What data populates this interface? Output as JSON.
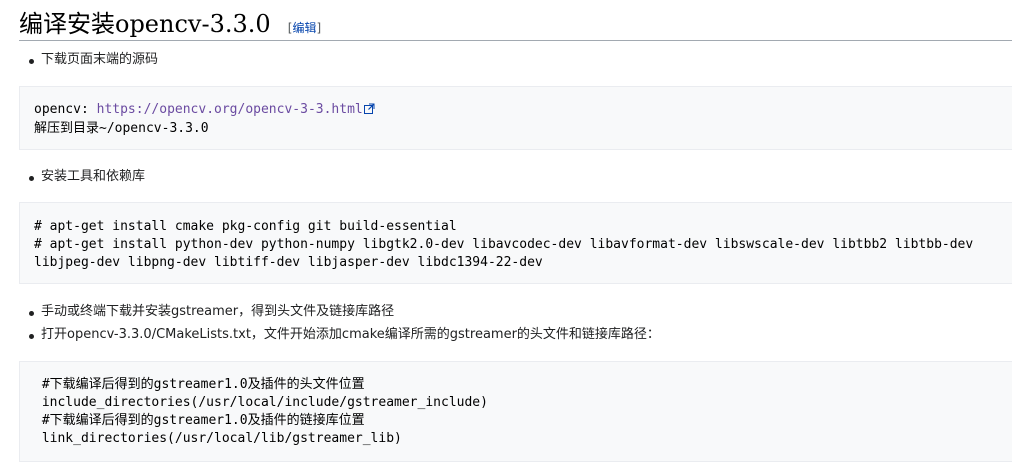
{
  "heading": {
    "title": "编译安装opencv-3.3.0",
    "edit_open": "[",
    "edit_label": "编辑",
    "edit_close": "]"
  },
  "items": [
    {
      "text": "下载页面末端的源码"
    },
    {
      "text": "安装工具和依赖库"
    },
    {
      "text": "手动或终端下载并安装gstreamer，得到头文件及链接库路径"
    },
    {
      "text": "打开opencv-3.3.0/CMakeLists.txt，文件开始添加cmake编译所需的gstreamer的头文件和链接库路径："
    }
  ],
  "code1": {
    "prefix": "opencv: ",
    "url": "https://opencv.org/opencv-3-3.html",
    "line2": "解压到目录~/opencv-3.3.0"
  },
  "code2": {
    "lines": [
      "# apt-get install cmake pkg-config git build-essential",
      "# apt-get install python-dev python-numpy libgtk2.0-dev libavcodec-dev libavformat-dev libswscale-dev libtbb2 libtbb-dev",
      "libjpeg-dev libpng-dev libtiff-dev libjasper-dev libdc1394-22-dev"
    ]
  },
  "code3": {
    "lines": [
      " #下载编译后得到的gstreamer1.0及插件的头文件位置",
      " include_directories(/usr/local/include/gstreamer_include)",
      " #下载编译后得到的gstreamer1.0及插件的链接库位置",
      " link_directories(/usr/local/lib/gstreamer_lib)"
    ]
  },
  "colors": {
    "link": "#0645ad",
    "visited_link": "#6b4ba1",
    "code_bg": "#f8f9fa"
  },
  "icons": {
    "external_link": "external-link-icon"
  }
}
